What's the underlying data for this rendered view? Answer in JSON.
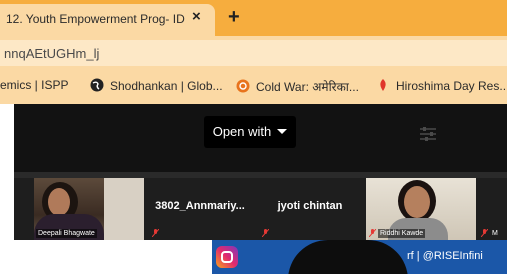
{
  "tab": {
    "title": "12. Youth Empowerment Prog- ID",
    "close": "×",
    "new_tab": "+"
  },
  "url": {
    "text": "nnqAEtUGHm_lj"
  },
  "bookmarks": [
    {
      "label": "emics | ISPP",
      "icon": ""
    },
    {
      "label": "Shodhankan | Glob...",
      "icon": "globe-icon"
    },
    {
      "label": "Cold War: अमेरिका...",
      "icon": "rss-icon"
    },
    {
      "label": "Hiroshima Day Res...",
      "icon": "bookmark-icon"
    }
  ],
  "viewer": {
    "open_with_label": "Open with"
  },
  "participants": [
    {
      "name": "Deepali Bhagwate",
      "has_video": true
    },
    {
      "name": "3802_Annmariy...",
      "has_video": false
    },
    {
      "name": "jyoti chintan",
      "has_video": false
    },
    {
      "name": "Riddhi Kawde",
      "has_video": true
    },
    {
      "name": "M",
      "has_video": false
    }
  ],
  "banner": {
    "text": "rf  |  @RISEInfini"
  },
  "colors": {
    "tab_strip": "#f6ad3e",
    "toolbar": "#fbd9a4",
    "viewer_bg": "#121212",
    "banner": "#1b57a8"
  }
}
